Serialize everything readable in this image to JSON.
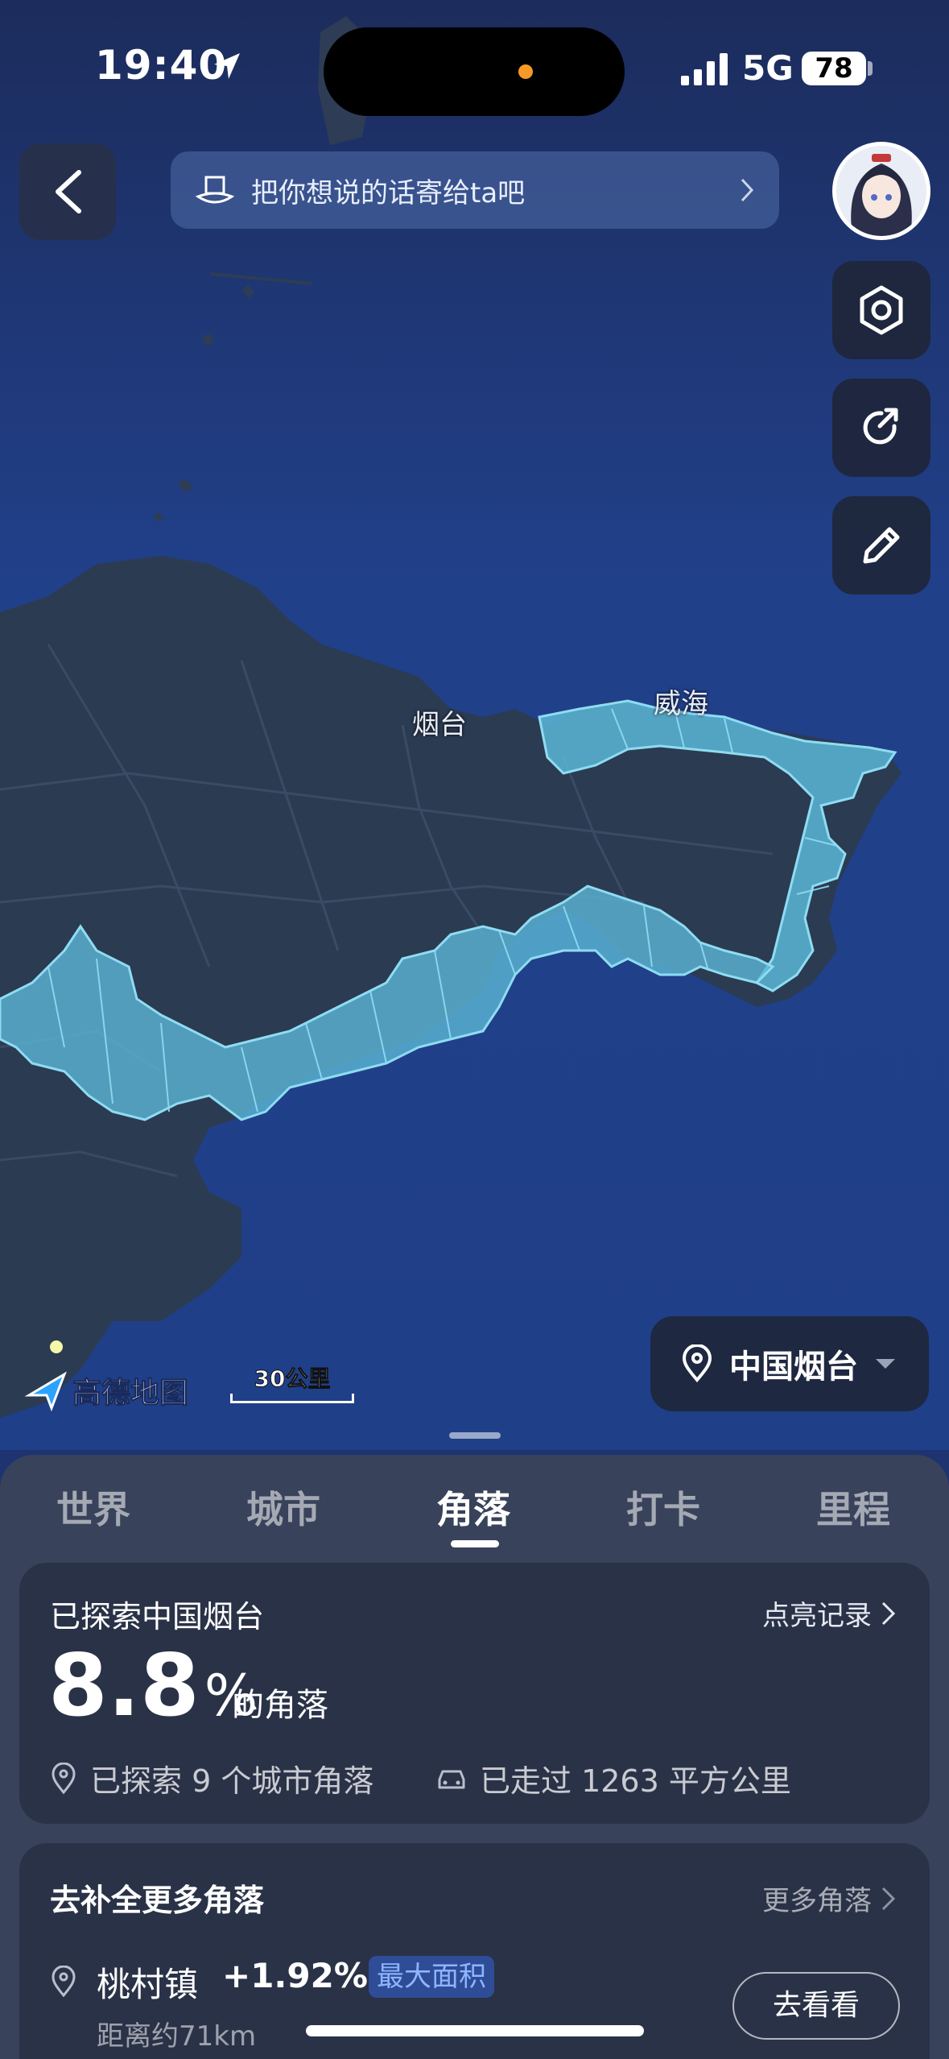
{
  "status_bar": {
    "time": "19:40",
    "network": "5G",
    "battery": "78"
  },
  "top_bar": {
    "message_placeholder": "把你想说的话寄给ta吧"
  },
  "map": {
    "labels": {
      "yantai": "烟台",
      "weihai": "威海"
    },
    "provider_logo": "高德地图",
    "scale_label": "30公里",
    "region_button": "中国烟台",
    "colors": {
      "ocean": "#1d3470",
      "land": "#2b3b52",
      "explored": "#5bb7d6"
    }
  },
  "tabs": [
    {
      "label": "世界",
      "active": false
    },
    {
      "label": "城市",
      "active": false
    },
    {
      "label": "角落",
      "active": true
    },
    {
      "label": "打卡",
      "active": false
    },
    {
      "label": "里程",
      "active": false
    }
  ],
  "explored_card": {
    "title": "已探索中国烟台",
    "link": "点亮记录",
    "percent": "8.8",
    "percent_sign": "%",
    "suffix": "的角落",
    "stat_corners": "已探索 9 个城市角落",
    "stat_area": "已走过 1263 平方公里"
  },
  "more_card": {
    "title": "去补全更多角落",
    "link": "更多角落",
    "row": {
      "name": "桃村镇",
      "percent": "+1.92%",
      "badge": "最大面积",
      "distance": "距离约71km",
      "button": "去看看"
    }
  }
}
